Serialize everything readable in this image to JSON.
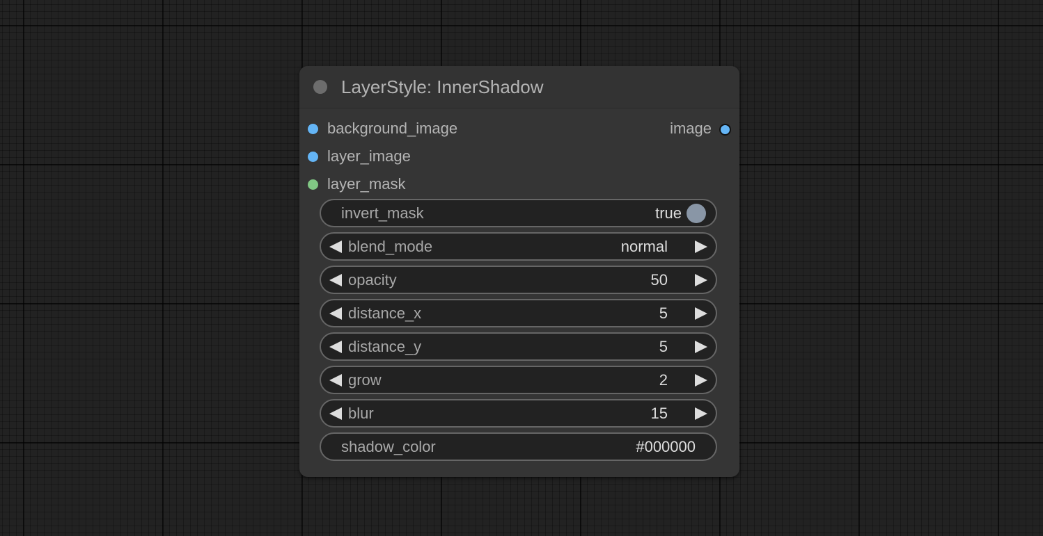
{
  "node": {
    "title": "LayerStyle: InnerShadow",
    "inputs": [
      {
        "label": "background_image",
        "color": "#64b5f6"
      },
      {
        "label": "layer_image",
        "color": "#64b5f6"
      },
      {
        "label": "layer_mask",
        "color": "#81c784"
      }
    ],
    "output": {
      "label": "image",
      "color": "#64b5f6"
    },
    "widgets": {
      "invert_mask": {
        "name": "invert_mask",
        "value": "true"
      },
      "blend_mode": {
        "name": "blend_mode",
        "value": "normal"
      },
      "opacity": {
        "name": "opacity",
        "value": "50"
      },
      "distance_x": {
        "name": "distance_x",
        "value": "5"
      },
      "distance_y": {
        "name": "distance_y",
        "value": "5"
      },
      "grow": {
        "name": "grow",
        "value": "2"
      },
      "blur": {
        "name": "blur",
        "value": "15"
      },
      "shadow_color": {
        "name": "shadow_color",
        "value": "#000000"
      }
    }
  },
  "icons": {
    "collapse": "collapse-dot-icon",
    "decrement": "triangle-left-icon",
    "increment": "triangle-right-icon",
    "toggle": "toggle-knob-icon"
  },
  "colors": {
    "canvas_bg": "#222222",
    "node_bg": "#353535",
    "widget_bg": "#222222",
    "widget_border": "#666666",
    "image_slot": "#64b5f6",
    "mask_slot": "#81c784",
    "toggle_on": "#8996a6"
  }
}
